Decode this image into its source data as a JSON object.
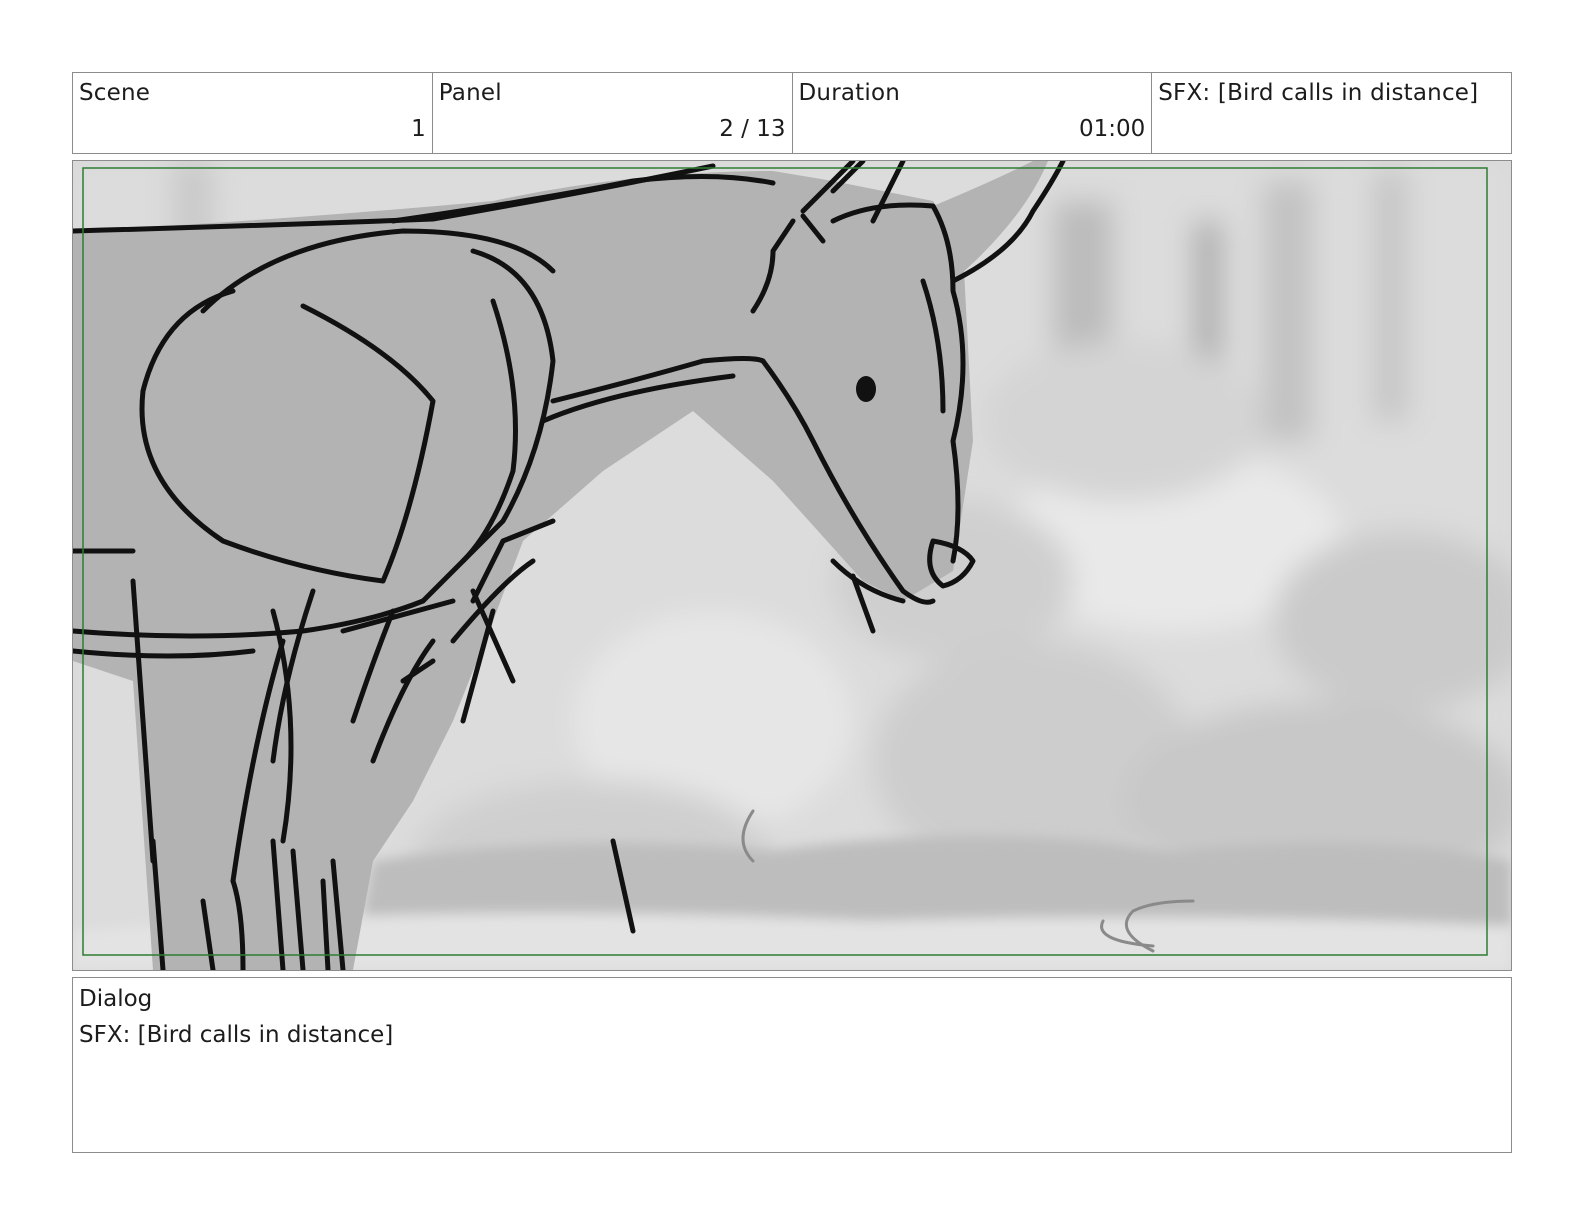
{
  "header": {
    "scene_label": "Scene",
    "scene_value": "1",
    "panel_label": "Panel",
    "panel_value": "2 / 13",
    "duration_label": "Duration",
    "duration_value": "01:00",
    "notes": "SFX: [Bird calls in distance]"
  },
  "panel": {
    "safe_area_color": "#2e7d32",
    "subject_fill": "#b3b3b3",
    "line_color": "#111111"
  },
  "dialog": {
    "label": "Dialog",
    "text": "SFX: [Bird calls in distance]"
  }
}
